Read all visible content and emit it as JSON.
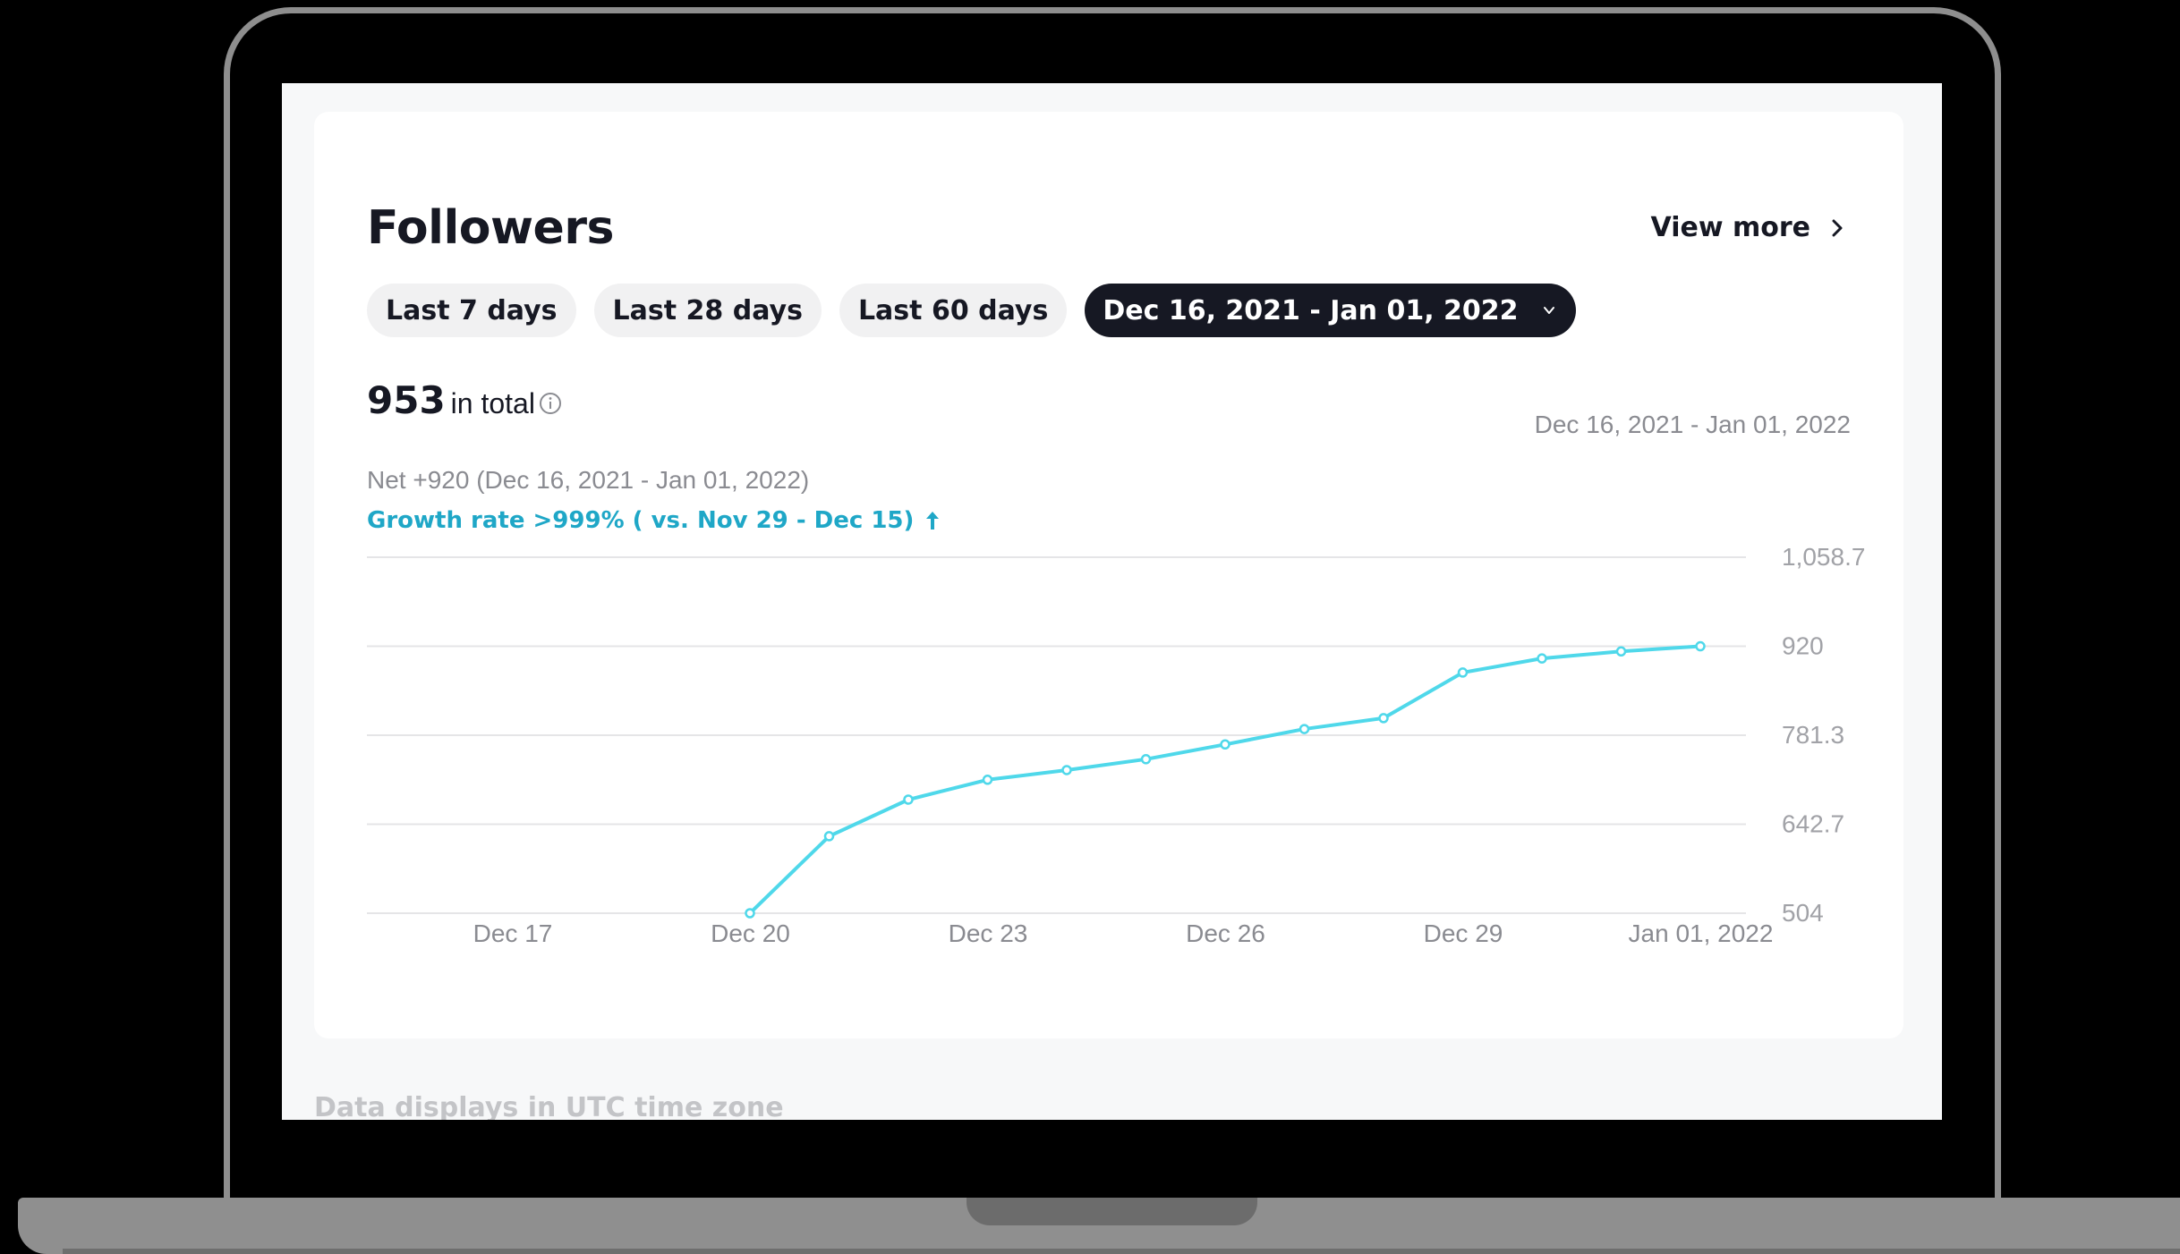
{
  "card": {
    "title": "Followers",
    "view_more_label": "View more",
    "tabs": [
      {
        "label": "Last 7 days",
        "active": false
      },
      {
        "label": "Last 28 days",
        "active": false
      },
      {
        "label": "Last 60 days",
        "active": false
      },
      {
        "label": "Dec 16, 2021 - Jan 01, 2022",
        "active": true
      }
    ],
    "total_value": "953",
    "total_label": "in total",
    "range_label": "Dec 16, 2021 - Jan 01, 2022",
    "net_text": "Net +920 (Dec 16, 2021 - Jan 01, 2022)",
    "growth_text": "Growth rate >999% ( vs. Nov 29 - Dec 15)"
  },
  "footer": {
    "note": "Data displays in UTC time zone"
  },
  "colors": {
    "line": "#4fd8ea",
    "accent": "#1fa7c7",
    "active_tab": "#161823"
  },
  "icons": [
    "chevron-right-icon",
    "chevron-down-icon",
    "info-icon",
    "arrow-up-icon"
  ],
  "chart_data": {
    "type": "line",
    "x": [
      "Dec 20",
      "Dec 21",
      "Dec 22",
      "Dec 23",
      "Dec 24",
      "Dec 25",
      "Dec 26",
      "Dec 27",
      "Dec 28",
      "Dec 29",
      "Dec 30",
      "Dec 31",
      "Jan 01, 2022"
    ],
    "series": [
      {
        "values": [
          504,
          624,
          681,
          712,
          727,
          744,
          767,
          791,
          808,
          879,
          901,
          912,
          920
        ]
      }
    ],
    "x_ticks": [
      "Dec 17",
      "Dec 20",
      "Dec 23",
      "Dec 26",
      "Dec 29",
      "Jan 01, 2022"
    ],
    "y_ticks": [
      "504",
      "642.7",
      "781.3",
      "920",
      "1,058.7"
    ],
    "ylim": [
      504,
      1058.7
    ],
    "grid": true
  }
}
